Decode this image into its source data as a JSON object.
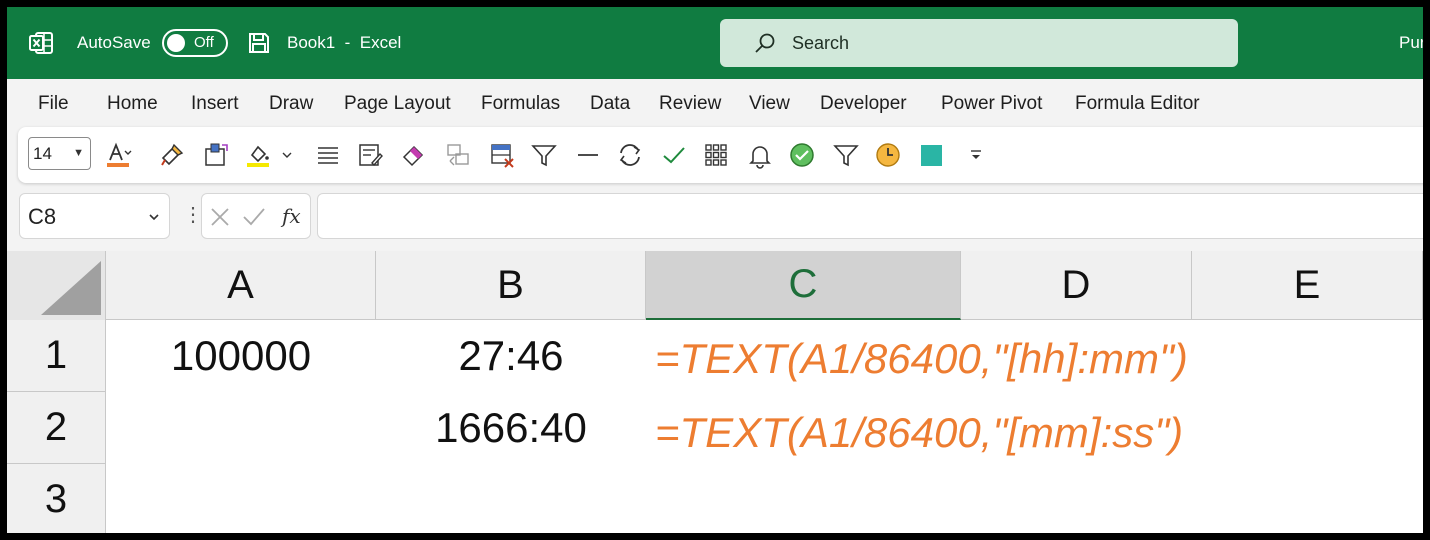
{
  "titlebar": {
    "autosave_label": "AutoSave",
    "autosave_state": "Off",
    "book_title": "Book1  -  Excel",
    "search_placeholder": "Search",
    "user_partial": "Pur",
    "bg_color": "#107c41"
  },
  "menu": {
    "items": [
      "File",
      "Home",
      "Insert",
      "Draw",
      "Page Layout",
      "Formulas",
      "Data",
      "Review",
      "View",
      "Developer",
      "Power Pivot",
      "Formula Editor"
    ]
  },
  "toolbar": {
    "font_size": "14",
    "icons": [
      "font-color-icon",
      "format-painter-icon",
      "merge-icon",
      "fill-color-icon",
      "align-icon",
      "clear-formats-icon",
      "eraser-icon",
      "copy-format-icon",
      "delete-table-icon",
      "filter-icon",
      "line-icon",
      "refresh-icon",
      "check-icon",
      "grid-icon",
      "bell-icon",
      "accept-icon",
      "filter-outline-icon",
      "clock-icon",
      "square-icon",
      "more-icon"
    ],
    "font_color_swatch": "#ed7d31",
    "fill_color_swatch": "#f5e900",
    "square_color": "#2ab5a5",
    "clock_color": "#f5b740"
  },
  "formula_bar": {
    "name_box": "C8",
    "formula_value": ""
  },
  "grid": {
    "columns": [
      "A",
      "B",
      "C",
      "D",
      "E"
    ],
    "selected_column": "C",
    "rows": [
      "1",
      "2",
      "3"
    ],
    "cells": {
      "A1": "100000",
      "B1": "27:46",
      "B2": "1666:40"
    },
    "formulas": {
      "C1": "=TEXT(A1/86400,\"[hh]:mm\")",
      "C2": "=TEXT(A1/86400,\"[mm]:ss\")"
    },
    "formula_color": "#ed7d31"
  }
}
